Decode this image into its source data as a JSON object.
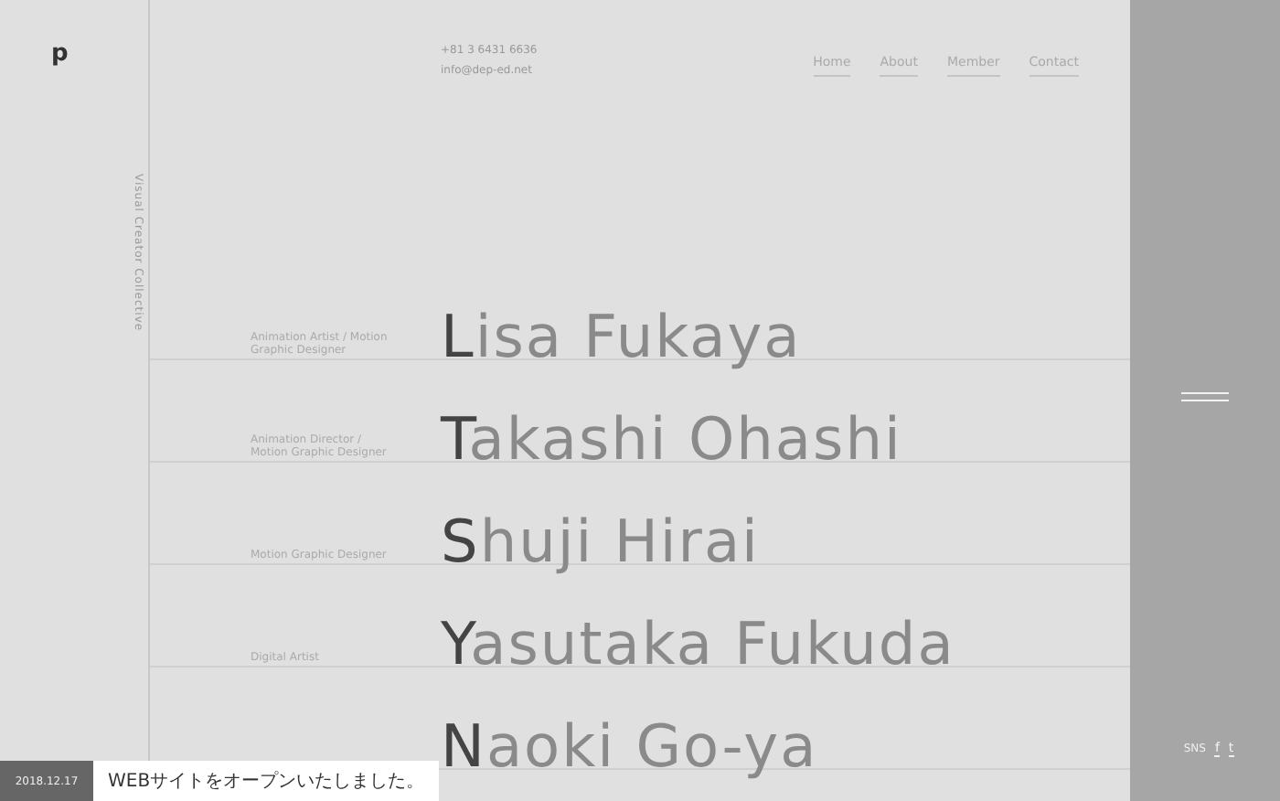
{
  "logo": {
    "mark": "p"
  },
  "tagline": "Visual Creator Collective",
  "contact": {
    "phone": "+81 3 6431 6636",
    "email": "info@dep-ed.net"
  },
  "nav": [
    {
      "label": "Home"
    },
    {
      "label": "About"
    },
    {
      "label": "Member"
    },
    {
      "label": "Contact"
    }
  ],
  "members": [
    {
      "role": "Animation Artist / Motion Graphic Designer",
      "initial": "L",
      "rest": "isa Fukaya"
    },
    {
      "role": "Animation Director / Motion Graphic Designer",
      "initial": "T",
      "rest": "akashi Ohashi"
    },
    {
      "role": "Motion Graphic Designer",
      "initial": "S",
      "rest": "huji Hirai"
    },
    {
      "role": "Digital Artist",
      "initial": "Y",
      "rest": "asutaka Fukuda"
    },
    {
      "initial": "N",
      "rest": "aoki Go-ya"
    }
  ],
  "side_bar": {
    "sns_label": "SNS",
    "sns_links": [
      "f",
      "t"
    ]
  },
  "notice": {
    "date": "2018.12.17",
    "text": "WEBサイトをオープンいたしました。"
  }
}
